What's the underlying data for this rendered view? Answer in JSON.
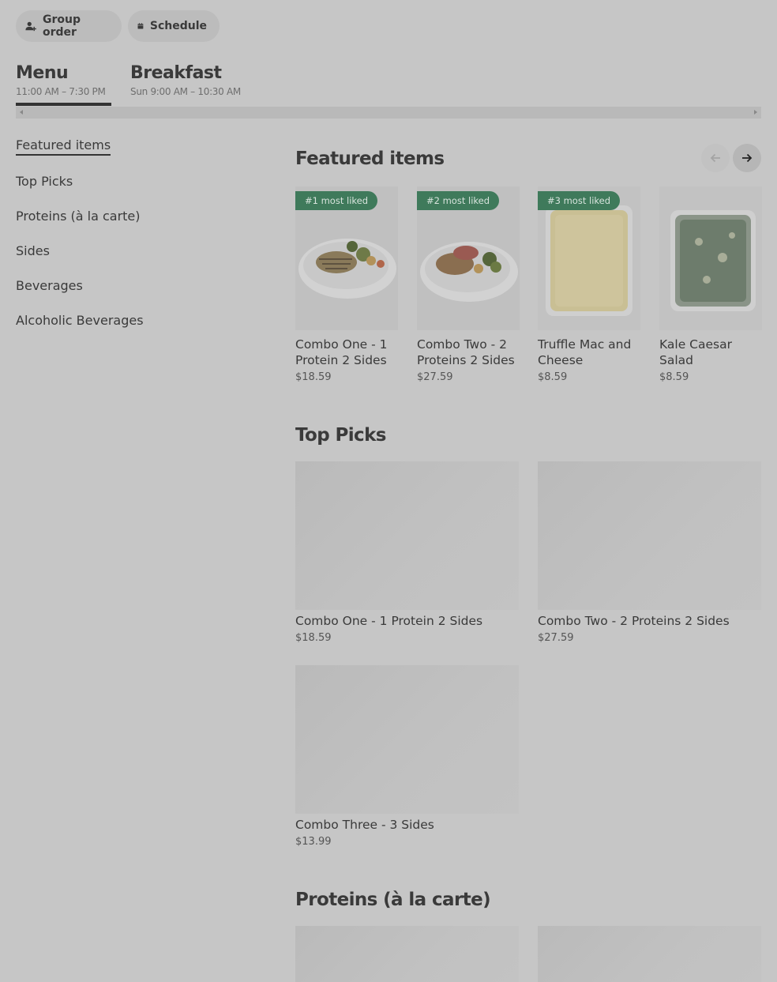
{
  "top_actions": {
    "group_order": "Group order",
    "schedule": "Schedule"
  },
  "menus": [
    {
      "title": "Menu",
      "hours": "11:00 AM – 7:30 PM",
      "active": true
    },
    {
      "title": "Breakfast",
      "hours": "Sun 9:00 AM – 10:30 AM",
      "active": false
    }
  ],
  "sidebar": {
    "items": [
      {
        "label": "Featured items",
        "active": true
      },
      {
        "label": "Top Picks"
      },
      {
        "label": "Proteins (à la carte)"
      },
      {
        "label": "Sides"
      },
      {
        "label": "Beverages"
      },
      {
        "label": "Alcoholic Beverages"
      }
    ]
  },
  "featured": {
    "title": "Featured items",
    "items": [
      {
        "badge": "#1 most liked",
        "name": "Combo One - 1 Protein 2 Sides",
        "price": "$18.59"
      },
      {
        "badge": "#2 most liked",
        "name": "Combo Two - 2 Proteins 2 Sides",
        "price": "$27.59"
      },
      {
        "badge": "#3 most liked",
        "name": "Truffle Mac and Cheese",
        "price": "$8.59"
      },
      {
        "badge": "",
        "name": "Kale Caesar Salad",
        "price": "$8.59"
      }
    ]
  },
  "top_picks": {
    "title": "Top Picks",
    "items": [
      {
        "name": "Combo One - 1 Protein 2 Sides",
        "price": "$18.59"
      },
      {
        "name": "Combo Two - 2 Proteins 2 Sides",
        "price": "$27.59"
      },
      {
        "name": "Combo Three - 3 Sides",
        "price": "$13.99"
      }
    ]
  },
  "proteins": {
    "title": "Proteins (à la carte)"
  },
  "colors": {
    "badge": "#3f7a5b",
    "page_bg": "#c6c6c6"
  }
}
